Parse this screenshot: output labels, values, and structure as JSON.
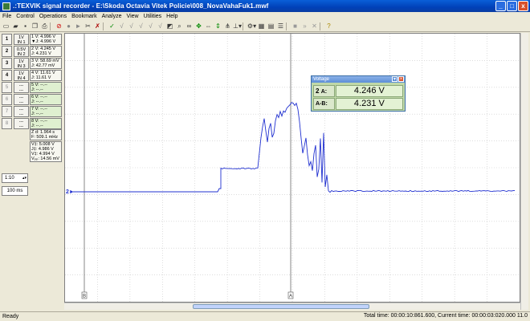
{
  "window": {
    "title": ".:TEXVIK  signal recorder  - E:\\Skoda Octavia Vitek Policie\\008_NovaVahaFuk1.mwf",
    "min": "_",
    "max": "□",
    "close": "x"
  },
  "menu": [
    "File",
    "Control",
    "Operations",
    "Bookmark",
    "Analyze",
    "View",
    "Utilities",
    "Help"
  ],
  "channels": [
    {
      "btn": "1",
      "label1": "1V",
      "label2": "IN 1",
      "row1": "1  V: 4.996 V",
      "row2": "▼J: 4.996 V",
      "active": true
    },
    {
      "btn": "2",
      "label1": "0.5V",
      "label2": "IN 2",
      "row1": "2  V: 4.245 V",
      "row2": "J: 4.231 V",
      "active": true
    },
    {
      "btn": "3",
      "label1": "1V",
      "label2": "IN 3",
      "row1": "3  V: 58.69 mV",
      "row2": "J: 42.77 mV",
      "active": true
    },
    {
      "btn": "4",
      "label1": "1V",
      "label2": "IN 4",
      "row1": "4  V: 11.61 V",
      "row2": "J: 11.61 V",
      "active": true
    },
    {
      "btn": "5",
      "label1": "---",
      "label2": "---",
      "row1": "5  V: --.--",
      "row2": "J: --.--",
      "active": false
    },
    {
      "btn": "6",
      "label1": "---",
      "label2": "---",
      "row1": "6  V: --.--",
      "row2": "J: --.--",
      "active": false
    },
    {
      "btn": "7",
      "label1": "---",
      "label2": "---",
      "row1": "7  V: --.--",
      "row2": "J: --.--",
      "active": false
    },
    {
      "btn": "8",
      "label1": "---",
      "label2": "---",
      "row1": "8  V: --.--",
      "row2": "J: --.--",
      "active": false
    }
  ],
  "time_info": {
    "dt": "Z d: 1.964 s",
    "f": "F: 509.1 mHz"
  },
  "stats_info": {
    "vmax": "V‡: 5.008 V",
    "vmin": "J‡: 4.986 V",
    "vavg": "V‡: 4.994 V",
    "vpp": "Vₚₚ: 14.56 mV"
  },
  "controls": {
    "zoom": "1:10",
    "time_div": "100 ms"
  },
  "voltage_window": {
    "title": "Voltage",
    "channel": "2",
    "a_label": "A:",
    "a_value": "4.246 V",
    "ab_label": "A-B:",
    "ab_value": "4.231 V"
  },
  "plot": {
    "channel_marker": "2",
    "cursor_a": "A",
    "cursor_b": "B",
    "trace_color": "#2030d0"
  },
  "status": {
    "ready": "Ready",
    "times": "Total time: 00:00:10:861.600,  Current time: 00:00:03:020.000    11.0"
  },
  "colors": {
    "title_bar": "#0041b8",
    "voltage_bg": "#c0d8a8",
    "grid": "#c8c8c8"
  }
}
